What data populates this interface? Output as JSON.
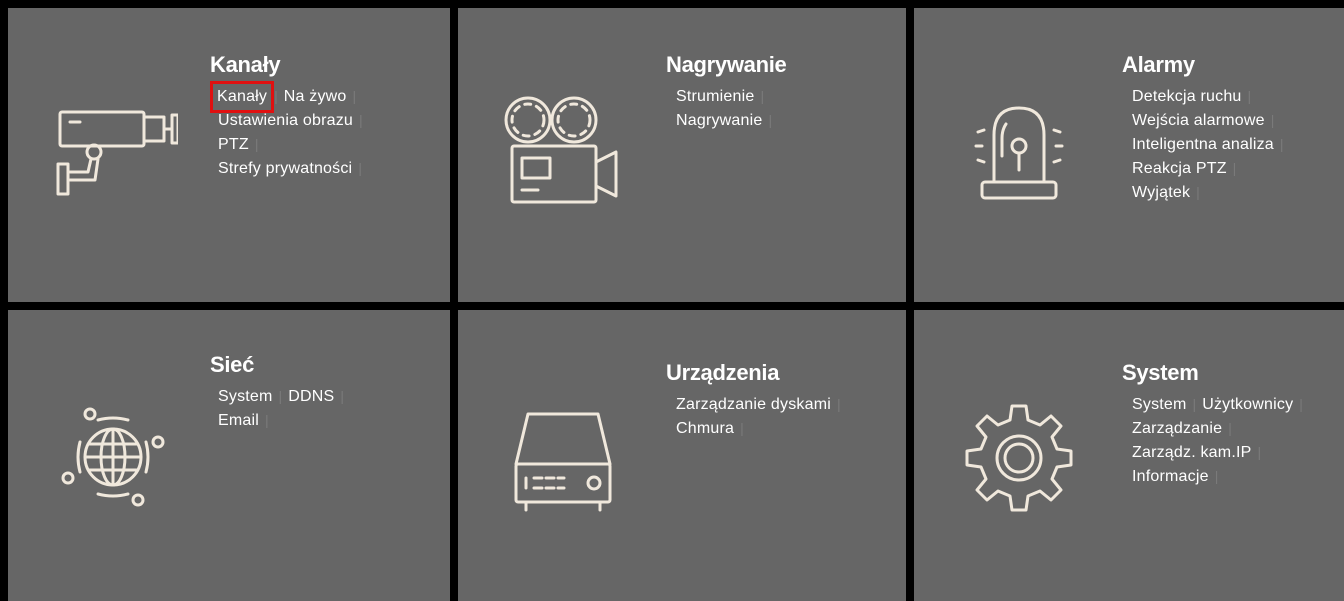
{
  "tiles": {
    "kanaly": {
      "title": "Kanały",
      "icon": "security-camera-icon",
      "rows": [
        [
          {
            "label": "Kanały",
            "selected": true
          },
          {
            "label": "Na żywo"
          }
        ],
        [
          {
            "label": "Ustawienia obrazu"
          }
        ],
        [
          {
            "label": "PTZ"
          }
        ],
        [
          {
            "label": "Strefy prywatności"
          }
        ]
      ]
    },
    "nagrywanie": {
      "title": "Nagrywanie",
      "icon": "film-camera-icon",
      "rows": [
        [
          {
            "label": "Strumienie"
          }
        ],
        [
          {
            "label": "Nagrywanie"
          }
        ]
      ]
    },
    "alarmy": {
      "title": "Alarmy",
      "icon": "alarm-siren-icon",
      "rows": [
        [
          {
            "label": "Detekcja ruchu"
          }
        ],
        [
          {
            "label": "Wejścia alarmowe"
          }
        ],
        [
          {
            "label": "Inteligentna analiza"
          }
        ],
        [
          {
            "label": "Reakcja PTZ"
          }
        ],
        [
          {
            "label": "Wyjątek"
          }
        ]
      ]
    },
    "siec": {
      "title": "Sieć",
      "icon": "globe-network-icon",
      "rows": [
        [
          {
            "label": "System"
          },
          {
            "label": "DDNS"
          }
        ],
        [
          {
            "label": "Email"
          }
        ]
      ]
    },
    "urzadzenia": {
      "title": "Urządzenia",
      "icon": "storage-device-icon",
      "rows": [
        [
          {
            "label": "Zarządzanie dyskami"
          }
        ],
        [
          {
            "label": "Chmura"
          }
        ]
      ]
    },
    "system": {
      "title": "System",
      "icon": "gear-icon",
      "rows": [
        [
          {
            "label": "System"
          },
          {
            "label": "Użytkownicy"
          }
        ],
        [
          {
            "label": "Zarządzanie"
          }
        ],
        [
          {
            "label": "Zarządz. kam.IP"
          }
        ],
        [
          {
            "label": "Informacje"
          }
        ]
      ]
    }
  },
  "colors": {
    "tile_bg": "#666666",
    "grid_bg": "#000000",
    "text": "#ffffff",
    "icon_stroke": "#f0e8dc",
    "selection": "#e01010",
    "separator": "#7a7a7a"
  }
}
